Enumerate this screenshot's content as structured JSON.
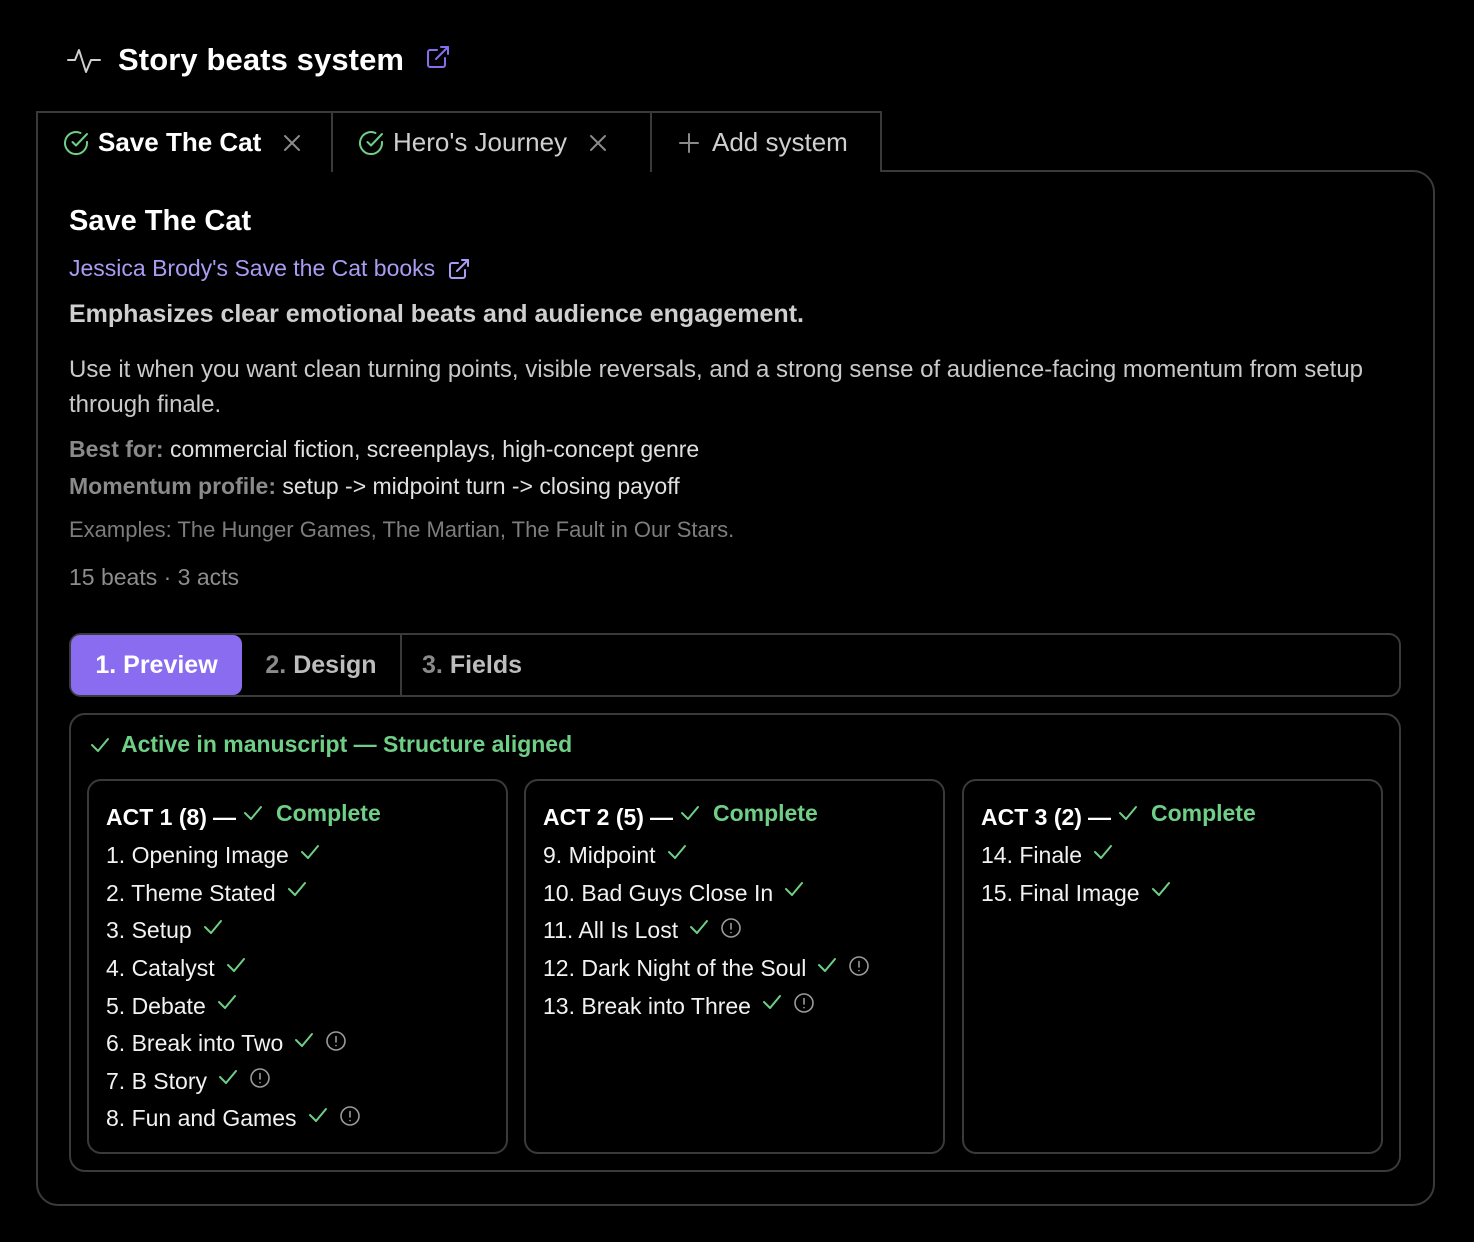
{
  "header": {
    "title": "Story beats system",
    "icon": "pulse-icon",
    "link_icon": "external-link-icon"
  },
  "system_tabs": [
    {
      "label": "Save The Cat",
      "active": true,
      "icon": "check-circle-icon",
      "close_icon": "close-icon"
    },
    {
      "label": "Hero's Journey",
      "active": false,
      "icon": "check-circle-icon",
      "close_icon": "close-icon"
    },
    {
      "label": "Add system",
      "active": false,
      "icon": "plus-icon"
    }
  ],
  "system": {
    "name": "Save The Cat",
    "source_link": "Jessica Brody's Save the Cat books",
    "summary": "Emphasizes clear emotional beats and audience engagement.",
    "description": "Use it when you want clean turning points, visible reversals, and a strong sense of audience-facing momentum from setup through finale.",
    "best_for_label": "Best for:",
    "best_for": "commercial fiction, screenplays, high-concept genre",
    "momentum_label": "Momentum profile:",
    "momentum": "setup -> midpoint turn -> closing payoff",
    "examples": "Examples: The Hunger Games, The Martian, The Fault in Our Stars.",
    "counts": "15 beats · 3 acts"
  },
  "steps": [
    {
      "num": "1.",
      "label": "Preview",
      "active": true
    },
    {
      "num": "2.",
      "label": "Design",
      "active": false
    },
    {
      "num": "3.",
      "label": "Fields",
      "active": false
    }
  ],
  "status": "Active in manuscript — Structure aligned",
  "colors": {
    "accent": "#8a6cf0",
    "link": "#a99cf3",
    "success": "#6fcf86",
    "border": "#3a3a3a",
    "background": "#000000"
  },
  "acts": [
    {
      "title": "ACT 1 (8)",
      "dash": "—",
      "state": "Complete",
      "beats": [
        {
          "label": "1. Opening Image",
          "warning": false
        },
        {
          "label": "2. Theme Stated",
          "warning": false
        },
        {
          "label": "3. Setup",
          "warning": false
        },
        {
          "label": "4. Catalyst",
          "warning": false
        },
        {
          "label": "5. Debate",
          "warning": false
        },
        {
          "label": "6. Break into Two",
          "warning": true
        },
        {
          "label": "7. B Story",
          "warning": true
        },
        {
          "label": "8. Fun and Games",
          "warning": true
        }
      ]
    },
    {
      "title": "ACT 2 (5)",
      "dash": "—",
      "state": "Complete",
      "beats": [
        {
          "label": "9. Midpoint",
          "warning": false
        },
        {
          "label": "10. Bad Guys Close In",
          "warning": false
        },
        {
          "label": "11. All Is Lost",
          "warning": true
        },
        {
          "label": "12. Dark Night of the Soul",
          "warning": true
        },
        {
          "label": "13. Break into Three",
          "warning": true
        }
      ]
    },
    {
      "title": "ACT 3 (2)",
      "dash": "—",
      "state": "Complete",
      "beats": [
        {
          "label": "14. Finale",
          "warning": false
        },
        {
          "label": "15. Final Image",
          "warning": false
        }
      ]
    }
  ]
}
